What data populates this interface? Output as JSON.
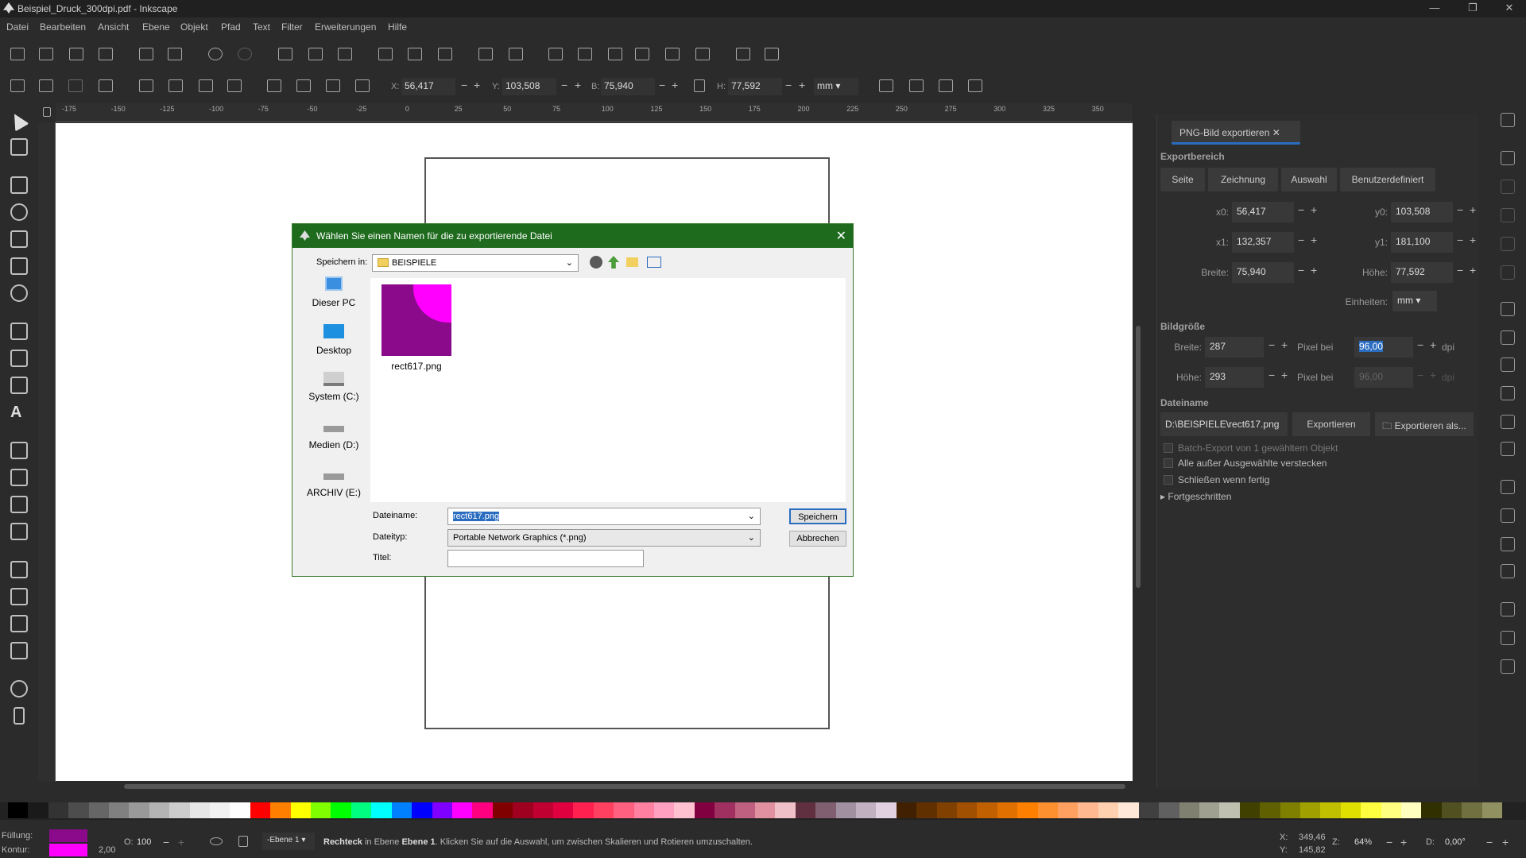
{
  "window": {
    "title": "Beispiel_Druck_300dpi.pdf - Inkscape"
  },
  "menu": [
    "Datei",
    "Bearbeiten",
    "Ansicht",
    "Ebene",
    "Objekt",
    "Pfad",
    "Text",
    "Filter",
    "Erweiterungen",
    "Hilfe"
  ],
  "controls": {
    "x_label": "X:",
    "x_value": "56,417",
    "y_label": "Y:",
    "y_value": "103,508",
    "w_label": "B:",
    "w_value": "75,940",
    "h_label": "H:",
    "h_value": "77,592",
    "unit": "mm"
  },
  "ruler_ticks": [
    "-175",
    "-150",
    "-125",
    "-100",
    "-75",
    "-50",
    "-25",
    "0",
    "25",
    "50",
    "75",
    "100",
    "125",
    "150",
    "175",
    "200",
    "225",
    "250",
    "275",
    "300",
    "325",
    "350"
  ],
  "dialog": {
    "title": "Wählen Sie einen Namen für die zu exportierende Datei",
    "save_in_label": "Speichern in:",
    "save_in_value": "BEISPIELE",
    "places": [
      "Dieser PC",
      "Desktop",
      "System (C:)",
      "Medien (D:)",
      "ARCHIV (E:)"
    ],
    "file_name": "rect617.png",
    "filename_label": "Dateiname:",
    "filename_value": "rect617.png",
    "filetype_label": "Dateityp:",
    "filetype_value": "Portable Network Graphics (*.png)",
    "title_label": "Titel:",
    "save_button": "Speichern",
    "cancel_button": "Abbrechen"
  },
  "panel": {
    "tab_title": "PNG-Bild exportieren",
    "export_area_heading": "Exportbereich",
    "area_tabs": [
      "Seite",
      "Zeichnung",
      "Auswahl",
      "Benutzerdefiniert"
    ],
    "x0_label": "x0:",
    "x0": "56,417",
    "y0_label": "y0:",
    "y0": "103,508",
    "x1_label": "x1:",
    "x1": "132,357",
    "y1_label": "y1:",
    "y1": "181,100",
    "width_label": "Breite:",
    "width": "75,940",
    "height_label": "Höhe:",
    "height": "77,592",
    "units_label": "Einheiten:",
    "units": "mm",
    "image_size_heading": "Bildgröße",
    "img_width_label": "Breite:",
    "img_width": "287",
    "img_height_label": "Höhe:",
    "img_height": "293",
    "pixel_at_label": "Pixel bei",
    "dpi_value": "96,00",
    "dpi_value_disabled": "96,00",
    "dpi_label": "dpi",
    "filename_heading": "Dateiname",
    "filename_value": "D:\\BEISPIELE\\rect617.png",
    "export_button": "Exportieren",
    "export_as_button": "Exportieren als...",
    "batch_export": "Batch-Export von 1 gewähltem Objekt",
    "hide_all": "Alle außer Ausgewählte verstecken",
    "close_when_done": "Schließen wenn fertig",
    "advanced": "Fortgeschritten"
  },
  "status": {
    "fill_label": "Füllung:",
    "stroke_label": "Kontur:",
    "stroke_width": "2,00",
    "opacity_label": "O:",
    "opacity": "100",
    "layer": "-Ebene 1",
    "message_bold": "Rechteck",
    "message_prefix": " in Ebene ",
    "message_layer": "Ebene 1",
    "message_rest": ". Klicken Sie auf die Auswahl, um zwischen Skalieren und Rotieren umzuschalten.",
    "x_label": "X:",
    "x": "349,46",
    "y_label": "Y:",
    "y": "145,82",
    "zoom_label": "Z:",
    "zoom": "64%",
    "rot_label": "D:",
    "rotation": "0,00°"
  },
  "colors": {
    "fill": "#8b0a8b",
    "stroke": "#ff00ff",
    "dialog_title": "#1e6b1e",
    "accent": "#2a6cc0"
  }
}
